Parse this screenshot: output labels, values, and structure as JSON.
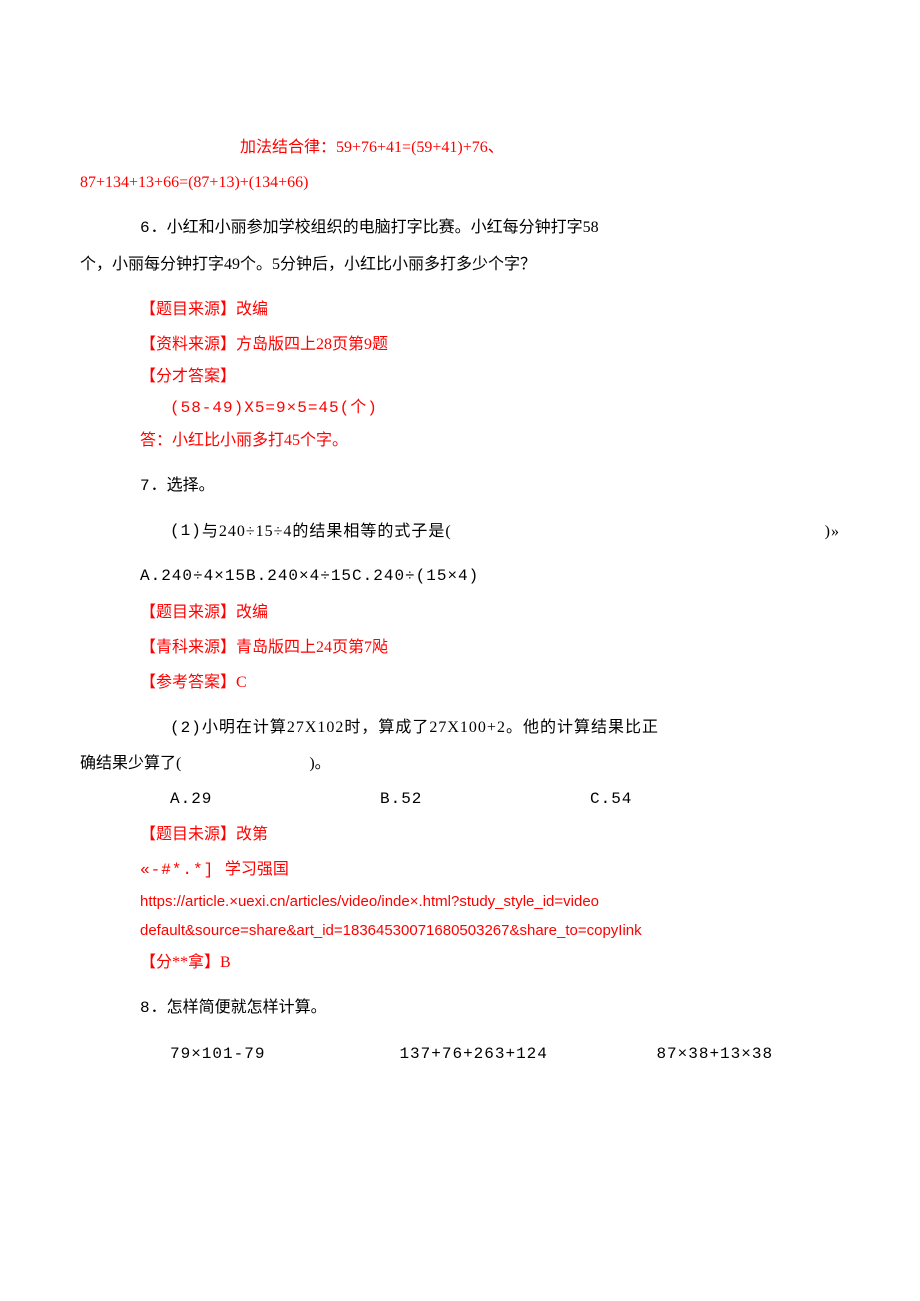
{
  "header1": "加法结合律：59+76+41=(59+41)+76、",
  "header2": "87+134+13+66=(87+13)+(134+66)",
  "q6": {
    "num": "6",
    "text1": "．小红和小丽参加学校组织的电脑打字比赛。小红每分钟打字58",
    "text2": "个，小丽每分钟打字49个。5分钟后，小红比小丽多打多少个字？",
    "source_label": "【题目来源】",
    "source_val": "改编",
    "ref_label": "【资料来源】",
    "ref_val": "方岛版四上28页第9题",
    "ans_label": "【分才答案】",
    "calc": "(58-49)X5=9×5=45(个)",
    "answer_text": "答：小红比小丽多打45个字。"
  },
  "q7": {
    "num": "7",
    "title": "．选择。",
    "p1": {
      "num": "(1)",
      "text": "与240÷15÷4的结果相等的式子是(",
      "close": ")»",
      "opts": "A.240÷4×15B.240×4÷15C.240÷(15×4)",
      "source_label": "【题目来源】",
      "source_val": "改编",
      "ref_label": "【青科来源】",
      "ref_val": "青岛版四上24页第7飐",
      "ans_label": "【参考答案】",
      "ans_val": "C"
    },
    "p2": {
      "num": "(2)",
      "text1": "小明在计算27X102时，算成了27X100+2。他的计算结果比正",
      "text2_pre": "确结果少算了(",
      "text2_close": ")。",
      "optA": "A.29",
      "optB": "B.52",
      "optC": "C.54",
      "source_label": "【题目未源】",
      "source_val": "改第",
      "ref_prefix": "«-#*.*] ",
      "ref_text": "学习强国",
      "link1": "https://article.×uexi.cn/articles/video/inde×.html?study_style_id=video",
      "link2": "default&source=share&art_id=18364530071680503267&share_to=copyIink",
      "ans_label": "【分**拿】",
      "ans_val": "B"
    }
  },
  "q8": {
    "num": "8",
    "title": "．怎样简便就怎样计算。",
    "e1": "79×101-79",
    "e2": "137+76+263+124",
    "e3": "87×38+13×38"
  }
}
